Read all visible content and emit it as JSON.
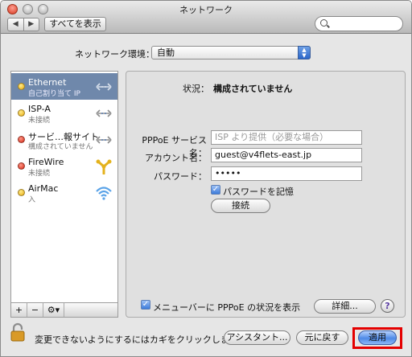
{
  "window": {
    "title": "ネットワーク"
  },
  "toolbar": {
    "back_label": "◀",
    "forward_label": "▶",
    "show_all_label": "すべてを表示",
    "search_placeholder": ""
  },
  "environment": {
    "label": "ネットワーク環境：",
    "value": "自動"
  },
  "services": [
    {
      "name": "Ethernet",
      "status": "自己割り当て IP",
      "dot": "yellow",
      "icon": "ethernet-icon",
      "selected": true
    },
    {
      "name": "ISP-A",
      "status": "未接続",
      "dot": "yellow",
      "icon": "ethernet-icon",
      "selected": false
    },
    {
      "name": "サービ…報サイト",
      "status": "構成されていません",
      "dot": "red",
      "icon": "ethernet-icon",
      "selected": false
    },
    {
      "name": "FireWire",
      "status": "未接続",
      "dot": "red",
      "icon": "firewire-icon",
      "selected": false
    },
    {
      "name": "AirMac",
      "status": "入",
      "dot": "yellow",
      "icon": "airmac-icon",
      "selected": false
    }
  ],
  "sidebar_controls": {
    "add": "+",
    "remove": "−",
    "gear": "⚙▾"
  },
  "detail": {
    "status_label": "状況：",
    "status_value": "構成されていません",
    "service_name_label": "PPPoE サービス名：",
    "service_name_placeholder": "ISP より提供（必要な場合）",
    "account_label": "アカウント名：",
    "account_value": "guest@v4flets-east.jp",
    "password_label": "パスワード：",
    "password_value": "•••••",
    "remember_label": "パスワードを記憶",
    "connect_label": "接続",
    "menubar_label": "メニューバーに PPPoE の状況を表示",
    "advanced_label": "詳細...",
    "help_label": "?"
  },
  "footer": {
    "lock_text": "変更できないようにするにはカギをクリックします。",
    "assistant_label": "アシスタント...",
    "revert_label": "元に戻す",
    "apply_label": "適用"
  },
  "colors": {
    "selection": "#6f88ab",
    "highlight_frame": "#e40000",
    "default_button": "#4f8ae6"
  }
}
